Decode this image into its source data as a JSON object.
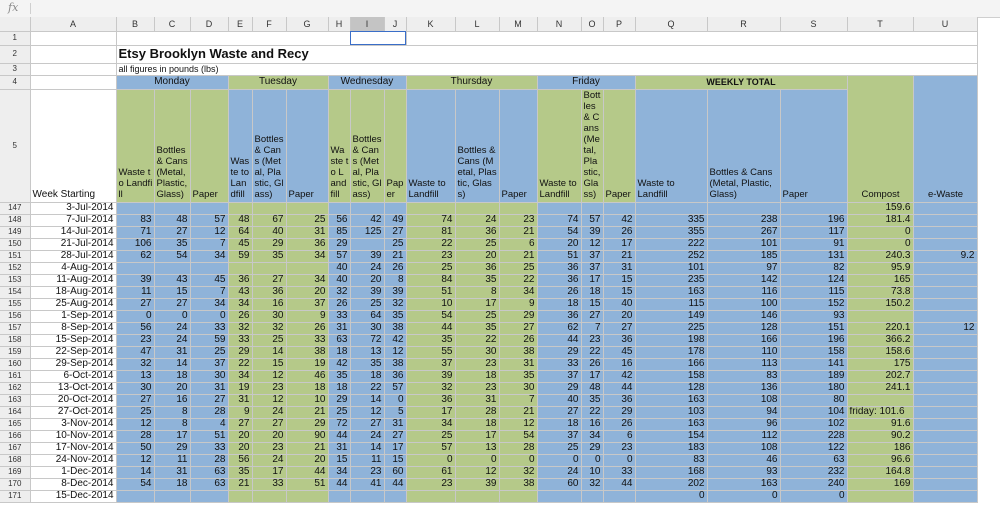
{
  "formula_bar": {
    "fx_label": "fx",
    "value": ""
  },
  "columns": [
    "A",
    "B",
    "C",
    "D",
    "E",
    "F",
    "G",
    "H",
    "I",
    "J",
    "K",
    "L",
    "M",
    "N",
    "O",
    "P",
    "Q",
    "R",
    "S",
    "T",
    "U"
  ],
  "selected_column": "I",
  "sheet": {
    "title": "Etsy Brooklyn Waste and Recy",
    "subtitle": "all figures in pounds (lbs)",
    "days": [
      "Monday",
      "Tuesday",
      "Wednesday",
      "Thursday",
      "Friday",
      "WEEKLY TOTAL"
    ],
    "week_starting_label": "Week Starting",
    "hdr_waste": "Waste to Landfill",
    "hdr_bottles": "Bottles & Cans (Metal, Plastic, Glass)",
    "hdr_paper": "Paper",
    "hdr_compost": "Compost",
    "hdr_ewaste": "e-Waste",
    "header_row_numbers": [
      "1",
      "2",
      "3",
      "4",
      "5"
    ]
  },
  "rows": [
    {
      "n": "147",
      "week": "3-Jul-2014",
      "v": [
        "",
        "",
        "",
        "",
        "",
        "",
        "",
        "",
        "",
        "",
        "",
        "",
        "",
        "",
        "",
        "",
        "",
        "",
        ""
      ],
      "t": "159.6",
      "u": ""
    },
    {
      "n": "148",
      "week": "7-Jul-2014",
      "v": [
        "83",
        "48",
        "57",
        "48",
        "67",
        "25",
        "56",
        "42",
        "49",
        "74",
        "24",
        "23",
        "74",
        "57",
        "42",
        "335",
        "238",
        "196"
      ],
      "t": "181.4",
      "u": ""
    },
    {
      "n": "149",
      "week": "14-Jul-2014",
      "v": [
        "71",
        "27",
        "12",
        "64",
        "40",
        "31",
        "85",
        "125",
        "27",
        "81",
        "36",
        "21",
        "54",
        "39",
        "26",
        "355",
        "267",
        "117"
      ],
      "t": "0",
      "u": ""
    },
    {
      "n": "150",
      "week": "21-Jul-2014",
      "v": [
        "106",
        "35",
        "7",
        "45",
        "29",
        "36",
        "29",
        "",
        "25",
        "22",
        "25",
        "6",
        "20",
        "12",
        "17",
        "222",
        "101",
        "91"
      ],
      "t": "0",
      "u": ""
    },
    {
      "n": "151",
      "week": "28-Jul-2014",
      "v": [
        "62",
        "54",
        "34",
        "59",
        "35",
        "34",
        "57",
        "39",
        "21",
        "23",
        "20",
        "21",
        "51",
        "37",
        "21",
        "252",
        "185",
        "131"
      ],
      "t": "240.3",
      "u": "9.2"
    },
    {
      "n": "152",
      "week": "4-Aug-2014",
      "v": [
        "",
        "",
        "",
        "",
        "",
        "",
        "40",
        "24",
        "26",
        "25",
        "36",
        "25",
        "36",
        "37",
        "31",
        "101",
        "97",
        "82"
      ],
      "t": "95.9",
      "u": ""
    },
    {
      "n": "153",
      "week": "11-Aug-2014",
      "v": [
        "39",
        "43",
        "45",
        "36",
        "27",
        "34",
        "40",
        "20",
        "8",
        "84",
        "35",
        "22",
        "36",
        "17",
        "15",
        "235",
        "142",
        "124"
      ],
      "t": "165",
      "u": ""
    },
    {
      "n": "154",
      "week": "18-Aug-2014",
      "v": [
        "11",
        "15",
        "7",
        "43",
        "36",
        "20",
        "32",
        "39",
        "39",
        "51",
        "8",
        "34",
        "26",
        "18",
        "15",
        "163",
        "116",
        "115"
      ],
      "t": "73.8",
      "u": ""
    },
    {
      "n": "155",
      "week": "25-Aug-2014",
      "v": [
        "27",
        "27",
        "34",
        "34",
        "16",
        "37",
        "26",
        "25",
        "32",
        "10",
        "17",
        "9",
        "18",
        "15",
        "40",
        "115",
        "100",
        "152"
      ],
      "t": "150.2",
      "u": ""
    },
    {
      "n": "156",
      "week": "1-Sep-2014",
      "v": [
        "0",
        "0",
        "0",
        "26",
        "30",
        "9",
        "33",
        "64",
        "35",
        "54",
        "25",
        "29",
        "36",
        "27",
        "20",
        "149",
        "146",
        "93"
      ],
      "t": "",
      "u": ""
    },
    {
      "n": "157",
      "week": "8-Sep-2014",
      "v": [
        "56",
        "24",
        "33",
        "32",
        "32",
        "26",
        "31",
        "30",
        "38",
        "44",
        "35",
        "27",
        "62",
        "7",
        "27",
        "225",
        "128",
        "151"
      ],
      "t": "220.1",
      "u": "12"
    },
    {
      "n": "158",
      "week": "15-Sep-2014",
      "v": [
        "23",
        "24",
        "59",
        "33",
        "25",
        "33",
        "63",
        "72",
        "42",
        "35",
        "22",
        "26",
        "44",
        "23",
        "36",
        "198",
        "166",
        "196"
      ],
      "t": "366.2",
      "u": ""
    },
    {
      "n": "159",
      "week": "22-Sep-2014",
      "v": [
        "47",
        "31",
        "25",
        "29",
        "14",
        "38",
        "18",
        "13",
        "12",
        "55",
        "30",
        "38",
        "29",
        "22",
        "45",
        "178",
        "110",
        "158"
      ],
      "t": "158.6",
      "u": ""
    },
    {
      "n": "160",
      "week": "29-Sep-2014",
      "v": [
        "32",
        "14",
        "37",
        "22",
        "15",
        "19",
        "42",
        "35",
        "38",
        "37",
        "23",
        "31",
        "33",
        "26",
        "16",
        "166",
        "113",
        "141"
      ],
      "t": "175",
      "u": ""
    },
    {
      "n": "161",
      "week": "6-Oct-2014",
      "v": [
        "13",
        "18",
        "30",
        "34",
        "12",
        "46",
        "35",
        "18",
        "36",
        "39",
        "18",
        "35",
        "37",
        "17",
        "42",
        "158",
        "83",
        "189"
      ],
      "t": "202.7",
      "u": ""
    },
    {
      "n": "162",
      "week": "13-Oct-2014",
      "v": [
        "30",
        "20",
        "31",
        "19",
        "23",
        "18",
        "18",
        "22",
        "57",
        "32",
        "23",
        "30",
        "29",
        "48",
        "44",
        "128",
        "136",
        "180"
      ],
      "t": "241.1",
      "u": ""
    },
    {
      "n": "163",
      "week": "20-Oct-2014",
      "v": [
        "27",
        "16",
        "27",
        "31",
        "12",
        "10",
        "29",
        "14",
        "0",
        "36",
        "31",
        "7",
        "40",
        "35",
        "36",
        "163",
        "108",
        "80"
      ],
      "t": "",
      "u": ""
    },
    {
      "n": "164",
      "week": "27-Oct-2014",
      "v": [
        "25",
        "8",
        "28",
        "9",
        "24",
        "21",
        "25",
        "12",
        "5",
        "17",
        "28",
        "21",
        "27",
        "22",
        "29",
        "103",
        "94",
        "104"
      ],
      "t": "friday: 101.6",
      "u": ""
    },
    {
      "n": "165",
      "week": "3-Nov-2014",
      "v": [
        "12",
        "8",
        "4",
        "27",
        "27",
        "29",
        "72",
        "27",
        "31",
        "34",
        "18",
        "12",
        "18",
        "16",
        "26",
        "163",
        "96",
        "102"
      ],
      "t": "91.6",
      "u": ""
    },
    {
      "n": "166",
      "week": "10-Nov-2014",
      "v": [
        "28",
        "17",
        "51",
        "20",
        "20",
        "90",
        "44",
        "24",
        "27",
        "25",
        "17",
        "54",
        "37",
        "34",
        "6",
        "154",
        "112",
        "228"
      ],
      "t": "90.2",
      "u": ""
    },
    {
      "n": "167",
      "week": "17-Nov-2014",
      "v": [
        "50",
        "29",
        "33",
        "20",
        "23",
        "21",
        "31",
        "14",
        "17",
        "57",
        "13",
        "28",
        "25",
        "29",
        "23",
        "183",
        "108",
        "122"
      ],
      "t": "186",
      "u": ""
    },
    {
      "n": "168",
      "week": "24-Nov-2014",
      "v": [
        "12",
        "11",
        "28",
        "56",
        "24",
        "20",
        "15",
        "11",
        "15",
        "0",
        "0",
        "0",
        "0",
        "0",
        "0",
        "83",
        "46",
        "63"
      ],
      "t": "96.6",
      "u": ""
    },
    {
      "n": "169",
      "week": "1-Dec-2014",
      "v": [
        "14",
        "31",
        "63",
        "35",
        "17",
        "44",
        "34",
        "23",
        "60",
        "61",
        "12",
        "32",
        "24",
        "10",
        "33",
        "168",
        "93",
        "232"
      ],
      "t": "164.8",
      "u": ""
    },
    {
      "n": "170",
      "week": "8-Dec-2014",
      "v": [
        "54",
        "18",
        "63",
        "21",
        "33",
        "51",
        "44",
        "41",
        "44",
        "23",
        "39",
        "38",
        "60",
        "32",
        "44",
        "202",
        "163",
        "240"
      ],
      "t": "169",
      "u": ""
    },
    {
      "n": "171",
      "week": "15-Dec-2014",
      "v": [
        "",
        "",
        "",
        "",
        "",
        "",
        "",
        "",
        "",
        "",
        "",
        "",
        "",
        "",
        "",
        "0",
        "0",
        "0"
      ],
      "t": "",
      "u": ""
    }
  ]
}
